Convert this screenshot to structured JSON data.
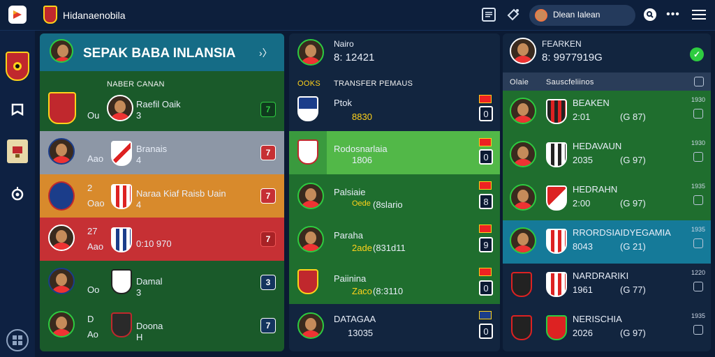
{
  "app": {
    "title": "Hidanaenobila",
    "search_value": "Dlean Ialean"
  },
  "panel1": {
    "title": "SEPAK BABA INLANSIA",
    "header_label": "NABER CANAN",
    "rows": [
      {
        "left": "Ou",
        "name": "Raefil Oaik",
        "value": "3"
      },
      {
        "left": "Aao",
        "name": "Branais",
        "value": "4"
      },
      {
        "top": "2",
        "left": "Oao",
        "name": "Naraa Kiaf Raisb Uain",
        "value": "4"
      },
      {
        "top": "27",
        "left": "Aao",
        "name": "0:10 970",
        "value": ""
      },
      {
        "left": "Oo",
        "name": "Damal",
        "value": "3"
      },
      {
        "top": "D",
        "left": "Ao",
        "name": "Doona",
        "value": "H"
      }
    ]
  },
  "panel2": {
    "player_name": "Nairo",
    "player_value": "8: 12421",
    "col_left": "OOKS",
    "col_right": "TRANSFER PEMAUS",
    "rows": [
      {
        "name": "Ptok",
        "sub": "8830",
        "score": "0"
      },
      {
        "name": "Rodosnarlaia",
        "sub": "1806",
        "score": "0"
      },
      {
        "name": "Palsiaie",
        "sub": "Oede",
        "sub2": "(8slario",
        "score": "8"
      },
      {
        "name": "Paraha",
        "sub": "2ade",
        "sub2": "(831d11",
        "score": "9"
      },
      {
        "name": "Paiinina",
        "sub": "Zaco",
        "sub2": "(8:3110",
        "score": "0"
      },
      {
        "name": "DATAGAA",
        "sub": "13035",
        "score": "0"
      }
    ]
  },
  "panel3": {
    "player_name": "FEARKEN",
    "player_value": "8: 9977919G",
    "col_left": "Olaie",
    "col_right": "Sauscfeliinos",
    "rows": [
      {
        "name": "BEAKEN",
        "year": "2:01",
        "rating": "(G 87)",
        "tiny": "1930"
      },
      {
        "name": "HEDAVAUN",
        "year": "2035",
        "rating": "(G 97)",
        "tiny": "1930"
      },
      {
        "name": "HEDRAHN",
        "year": "2:00",
        "rating": "(G 97)",
        "tiny": "1935"
      },
      {
        "name": "RRORDSIAIDYEGAMIA",
        "year": "8043",
        "rating": "(G 21)",
        "tiny": "1935"
      },
      {
        "name": "NARDRARIKI",
        "year": "1961",
        "rating": "(G 77)",
        "tiny": "1220"
      },
      {
        "name": "NERISCHIA",
        "year": "2026",
        "rating": "(G 97)",
        "tiny": "1935"
      }
    ]
  },
  "colors": {
    "green": "#1f6e2e",
    "gray": "#8d97a6",
    "orange": "#d88a2c",
    "red": "#c63034",
    "teal": "#157a99",
    "navy": "#0b1a33"
  }
}
